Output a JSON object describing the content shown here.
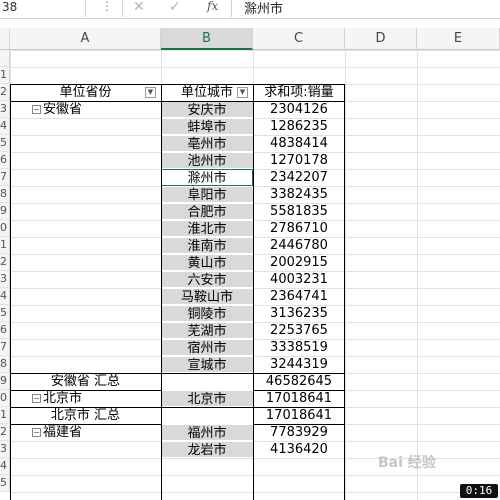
{
  "formula_bar": {
    "name_box": "38",
    "content": "滁州市",
    "fx": "fx",
    "cancel": "✕",
    "confirm": "✓"
  },
  "columns": [
    "A",
    "B",
    "C",
    "D",
    "E"
  ],
  "row_numbers": [
    "",
    "1",
    "2",
    "3",
    "4",
    "5",
    "6",
    "7",
    "8",
    "9",
    "0",
    "1",
    "2",
    "3",
    "4",
    "5",
    "6",
    "7",
    "8",
    "9",
    "0",
    "1",
    "2",
    "3",
    "4",
    "5"
  ],
  "pivot": {
    "header": {
      "province": "单位省份",
      "city": "单位城市",
      "sum": "求和项:销量"
    },
    "rows": [
      {
        "province": "安徽省",
        "city": "安庆市",
        "value": "2304126",
        "toggle": "⊟"
      },
      {
        "province": "",
        "city": "蚌埠市",
        "value": "1286235"
      },
      {
        "province": "",
        "city": "亳州市",
        "value": "4838414"
      },
      {
        "province": "",
        "city": "池州市",
        "value": "1270178"
      },
      {
        "province": "",
        "city": "滁州市",
        "value": "2342207",
        "active": true
      },
      {
        "province": "",
        "city": "阜阳市",
        "value": "3382435"
      },
      {
        "province": "",
        "city": "合肥市",
        "value": "5581835"
      },
      {
        "province": "",
        "city": "淮北市",
        "value": "2786710"
      },
      {
        "province": "",
        "city": "淮南市",
        "value": "2446780"
      },
      {
        "province": "",
        "city": "黄山市",
        "value": "2002915"
      },
      {
        "province": "",
        "city": "六安市",
        "value": "4003231"
      },
      {
        "province": "",
        "city": "马鞍山市",
        "value": "2364741"
      },
      {
        "province": "",
        "city": "铜陵市",
        "value": "3136235"
      },
      {
        "province": "",
        "city": "芜湖市",
        "value": "2253765"
      },
      {
        "province": "",
        "city": "宿州市",
        "value": "3338519"
      },
      {
        "province": "",
        "city": "宣城市",
        "value": "3244319"
      },
      {
        "province": "安徽省 汇总",
        "city": "",
        "value": "46582645",
        "subtotal": true
      },
      {
        "province": "北京市",
        "city": "北京市",
        "value": "17018641",
        "toggle": "⊟"
      },
      {
        "province": "北京市 汇总",
        "city": "",
        "value": "17018641",
        "subtotal": true
      },
      {
        "province": "福建省",
        "city": "福州市",
        "value": "7783929",
        "toggle": "⊟"
      },
      {
        "province": "",
        "city": "龙岩市",
        "value": "4136420"
      }
    ]
  },
  "timer": "0:16",
  "watermark": "Bai 经验"
}
